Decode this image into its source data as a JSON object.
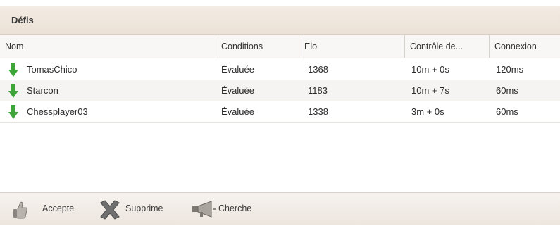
{
  "panel": {
    "title": "Défis"
  },
  "columns": [
    {
      "label": "Nom"
    },
    {
      "label": "Conditions"
    },
    {
      "label": "Elo"
    },
    {
      "label": "Contrôle de..."
    },
    {
      "label": "Connexion"
    }
  ],
  "rows": [
    {
      "name": "TomasChico",
      "conditions": "Évaluée",
      "elo": "1368",
      "control": "10m + 0s",
      "connection": "120ms",
      "icon": "green-down-arrow-icon"
    },
    {
      "name": "Starcon",
      "conditions": "Évaluée",
      "elo": "1183",
      "control": "10m + 7s",
      "connection": "60ms",
      "icon": "green-down-arrow-icon"
    },
    {
      "name": "Chessplayer03",
      "conditions": "Évaluée",
      "elo": "1338",
      "control": "3m + 0s",
      "connection": "60ms",
      "icon": "green-down-arrow-icon"
    }
  ],
  "toolbar": {
    "accept_label": "Accepte",
    "accept_icon": "thumbs-up-icon",
    "delete_label": "Supprime",
    "delete_icon": "delete-x-icon",
    "search_label": "Cherche",
    "search_icon": "megaphone-icon"
  },
  "colors": {
    "arrow_green": "#3fa53a",
    "title_bg": "#efe6dc",
    "header_bg": "#f9f7f5"
  }
}
